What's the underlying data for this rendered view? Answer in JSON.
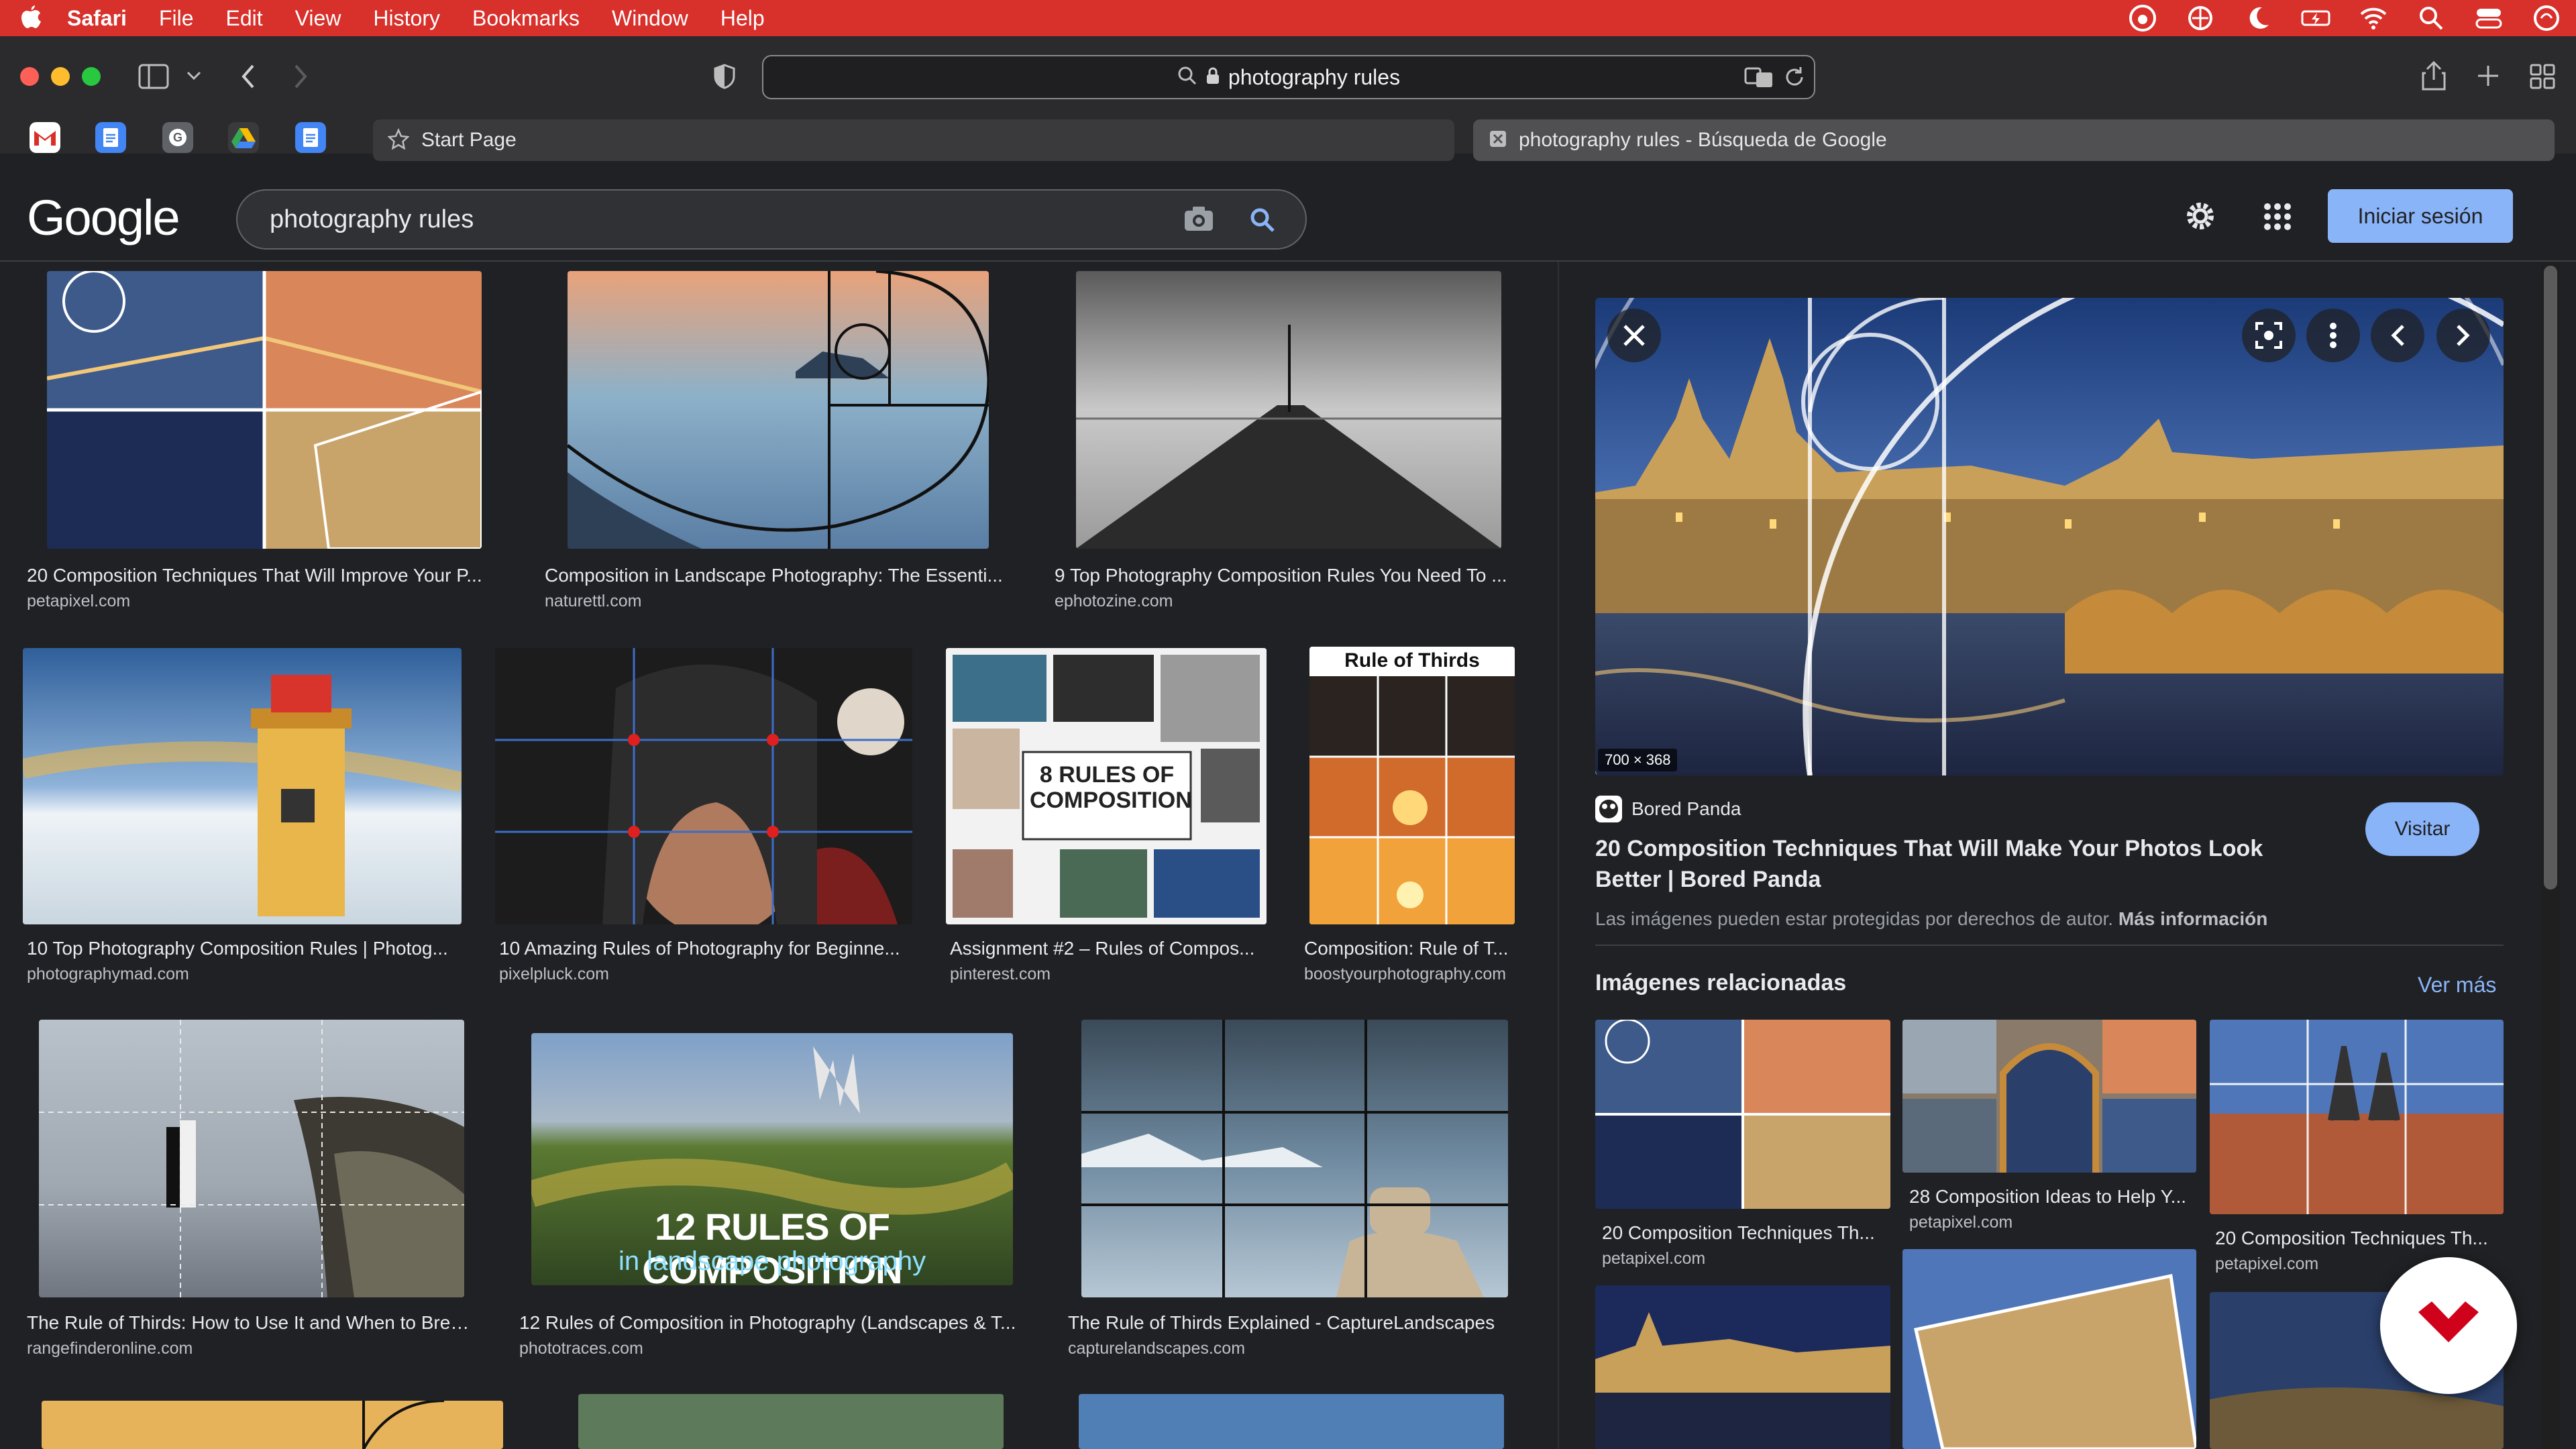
{
  "menubar": {
    "app": "Safari",
    "items": [
      "File",
      "Edit",
      "View",
      "History",
      "Bookmarks",
      "Window",
      "Help"
    ],
    "status_icons": [
      "creative-cloud-icon",
      "vpn-icon",
      "moon-icon",
      "battery-icon",
      "wifi-icon",
      "spotlight-icon",
      "control-center-icon",
      "siri-icon"
    ]
  },
  "browser": {
    "url": "photography rules",
    "tabs": [
      {
        "label": "Start Page"
      },
      {
        "label": "photography rules - Búsqueda de Google"
      }
    ]
  },
  "google": {
    "logo": "Google",
    "query": "photography rules",
    "signin": "Iniciar sesión"
  },
  "results": [
    {
      "title": "20 Composition Techniques That Will Improve Your P...",
      "source": "petapixel.com",
      "colors": [
        "#3d5a8a",
        "#d9865a",
        "#1d2c55",
        "#c9a46a"
      ]
    },
    {
      "title": "Composition in Landscape Photography: The Essenti...",
      "source": "naturettl.com",
      "colors": [
        "#e9a27a",
        "#5a7ea4",
        "#8db1c9",
        "#2d4056"
      ]
    },
    {
      "title": "9 Top Photography Composition Rules You Need To ...",
      "source": "ephotozine.com",
      "colors": [
        "#c9c9c9",
        "#6d6d6d",
        "#9a9a9a",
        "#2b2b2b"
      ]
    },
    {
      "title": "10 Top Photography Composition Rules | Photog...",
      "source": "photographymad.com",
      "colors": [
        "#4e7fc0",
        "#e9b64c",
        "#eef3f7",
        "#c98a2a"
      ]
    },
    {
      "title": "10 Amazing Rules of Photography for Beginne...",
      "source": "pixelpluck.com",
      "colors": [
        "#2c2c2c",
        "#b07a5e",
        "#7b1e1e",
        "#e0d6c9"
      ]
    },
    {
      "title": "Assignment #2 – Rules of Compos...",
      "source": "pinterest.com",
      "colors": [
        "#e8e8e8",
        "#3b6f8a",
        "#2d2d2d",
        "#9fb6c2"
      ]
    },
    {
      "title": "Composition: Rule of T...",
      "source": "boostyourphotography.com",
      "colors": [
        "#f2a23a",
        "#5b3a1e",
        "#2a2320",
        "#d06b2c"
      ]
    },
    {
      "title": "The Rule of Thirds: How to Use It and When to Brea...",
      "source": "rangefinderonline.com",
      "colors": [
        "#9fa7b0",
        "#6d6a5a",
        "#3c3a33",
        "#c9b28c"
      ]
    },
    {
      "title": "12 Rules of Composition in Photography (Landscapes & T...",
      "source": "phototraces.com",
      "colors": [
        "#7fa0c8",
        "#5b7a32",
        "#b3a540",
        "#2f4421"
      ]
    },
    {
      "title": "The Rule of Thirds Explained - CaptureLandscapes",
      "source": "capturelandscapes.com",
      "colors": [
        "#6f8aa0",
        "#b6c7d4",
        "#3a4a58",
        "#c8b598"
      ]
    }
  ],
  "overlay_text": {
    "rule_of_thirds": "Rule of Thirds",
    "eight_rules": "8 RULES OF\nCOMPOSITION",
    "twelve_rules": "12 RULES OF COMPOSITION",
    "twelve_sub": "in landscape photography"
  },
  "panel": {
    "size_badge": "700 × 368",
    "source": "Bored Panda",
    "title": "20 Composition Techniques That Will Make Your Photos Look Better | Bored Panda",
    "visit": "Visitar",
    "copyright": "Las imágenes pueden estar protegidas por derechos de autor.",
    "more_info": "Más información",
    "related_heading": "Imágenes relacionadas",
    "see_more": "Ver más",
    "related": [
      {
        "title": "20 Composition Techniques Th...",
        "source": "petapixel.com"
      },
      {
        "title": "28 Composition Ideas to Help Y...",
        "source": "petapixel.com"
      },
      {
        "title": "20 Composition Techniques Th...",
        "source": "petapixel.com"
      }
    ]
  }
}
